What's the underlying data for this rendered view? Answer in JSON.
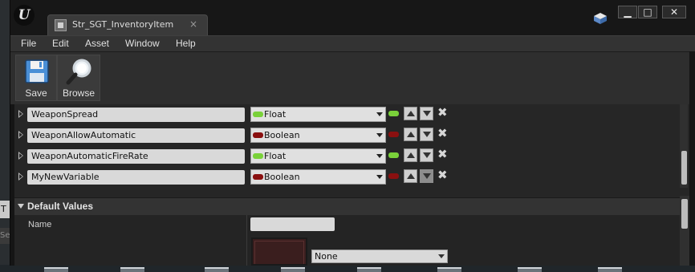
{
  "window": {
    "tab_title": "Str_SGT_InventoryItem",
    "tab_close": "×",
    "controls": {
      "minimize": "▁",
      "maximize": "□",
      "close": "✕"
    }
  },
  "menu": [
    "File",
    "Edit",
    "Asset",
    "Window",
    "Help"
  ],
  "toolbar": {
    "save_label": "Save",
    "browse_label": "Browse"
  },
  "variables": [
    {
      "name": "WeaponSpread",
      "type": "Float",
      "type_color": "#7ad13a"
    },
    {
      "name": "WeaponAllowAutomatic",
      "type": "Boolean",
      "type_color": "#8a1010"
    },
    {
      "name": "WeaponAutomaticFireRate",
      "type": "Float",
      "type_color": "#7ad13a"
    },
    {
      "name": "MyNewVariable",
      "type": "Boolean",
      "type_color": "#8a1010"
    }
  ],
  "defaults": {
    "header": "Default Values",
    "name_label": "Name",
    "name_value": "",
    "asset_select": "None"
  },
  "background": {
    "left_badge": "T",
    "left_field": "Se"
  }
}
